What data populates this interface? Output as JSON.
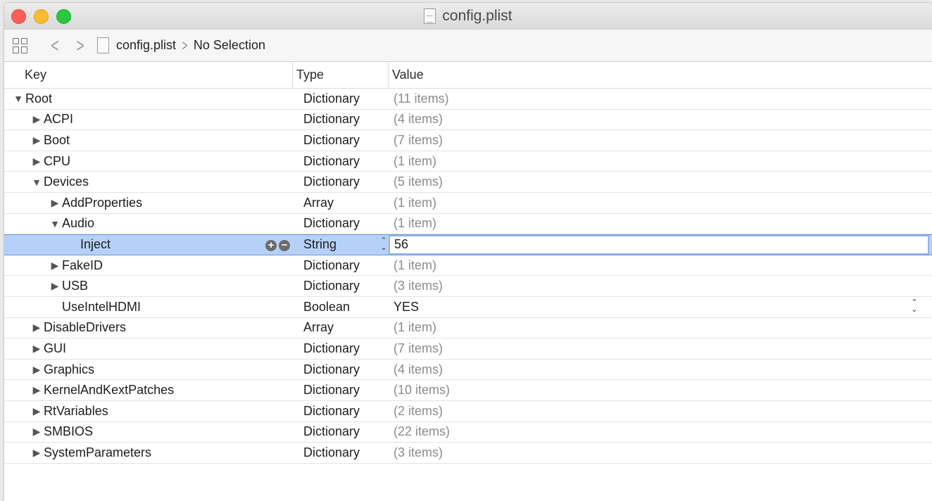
{
  "window": {
    "title": "config.plist"
  },
  "toolbar": {
    "crumb_file": "config.plist",
    "crumb_selection": "No Selection"
  },
  "columns": {
    "key": "Key",
    "type": "Type",
    "value": "Value"
  },
  "rows": [
    {
      "key": "Root",
      "indent": 0,
      "disclosure": "open",
      "type": "Dictionary",
      "value": "(11 items)",
      "muted": true
    },
    {
      "key": "ACPI",
      "indent": 1,
      "disclosure": "closed",
      "type": "Dictionary",
      "value": "(4 items)",
      "muted": true
    },
    {
      "key": "Boot",
      "indent": 1,
      "disclosure": "closed",
      "type": "Dictionary",
      "value": "(7 items)",
      "muted": true
    },
    {
      "key": "CPU",
      "indent": 1,
      "disclosure": "closed",
      "type": "Dictionary",
      "value": "(1 item)",
      "muted": true
    },
    {
      "key": "Devices",
      "indent": 1,
      "disclosure": "open",
      "type": "Dictionary",
      "value": "(5 items)",
      "muted": true
    },
    {
      "key": "AddProperties",
      "indent": 2,
      "disclosure": "closed",
      "type": "Array",
      "value": "(1 item)",
      "muted": true
    },
    {
      "key": "Audio",
      "indent": 2,
      "disclosure": "open",
      "type": "Dictionary",
      "value": "(1 item)",
      "muted": true
    },
    {
      "key": "Inject",
      "indent": 3,
      "disclosure": "none",
      "type": "String",
      "value": "56",
      "muted": false,
      "selected": true
    },
    {
      "key": "FakeID",
      "indent": 2,
      "disclosure": "closed",
      "type": "Dictionary",
      "value": "(1 item)",
      "muted": true
    },
    {
      "key": "USB",
      "indent": 2,
      "disclosure": "closed",
      "type": "Dictionary",
      "value": "(3 items)",
      "muted": true
    },
    {
      "key": "UseIntelHDMI",
      "indent": 2,
      "disclosure": "none",
      "type": "Boolean",
      "value": "YES",
      "muted": false,
      "boolean": true
    },
    {
      "key": "DisableDrivers",
      "indent": 1,
      "disclosure": "closed",
      "type": "Array",
      "value": "(1 item)",
      "muted": true
    },
    {
      "key": "GUI",
      "indent": 1,
      "disclosure": "closed",
      "type": "Dictionary",
      "value": "(7 items)",
      "muted": true
    },
    {
      "key": "Graphics",
      "indent": 1,
      "disclosure": "closed",
      "type": "Dictionary",
      "value": "(4 items)",
      "muted": true
    },
    {
      "key": "KernelAndKextPatches",
      "indent": 1,
      "disclosure": "closed",
      "type": "Dictionary",
      "value": "(10 items)",
      "muted": true
    },
    {
      "key": "RtVariables",
      "indent": 1,
      "disclosure": "closed",
      "type": "Dictionary",
      "value": "(2 items)",
      "muted": true
    },
    {
      "key": "SMBIOS",
      "indent": 1,
      "disclosure": "closed",
      "type": "Dictionary",
      "value": "(22 items)",
      "muted": true
    },
    {
      "key": "SystemParameters",
      "indent": 1,
      "disclosure": "closed",
      "type": "Dictionary",
      "value": "(3 items)",
      "muted": true
    }
  ]
}
